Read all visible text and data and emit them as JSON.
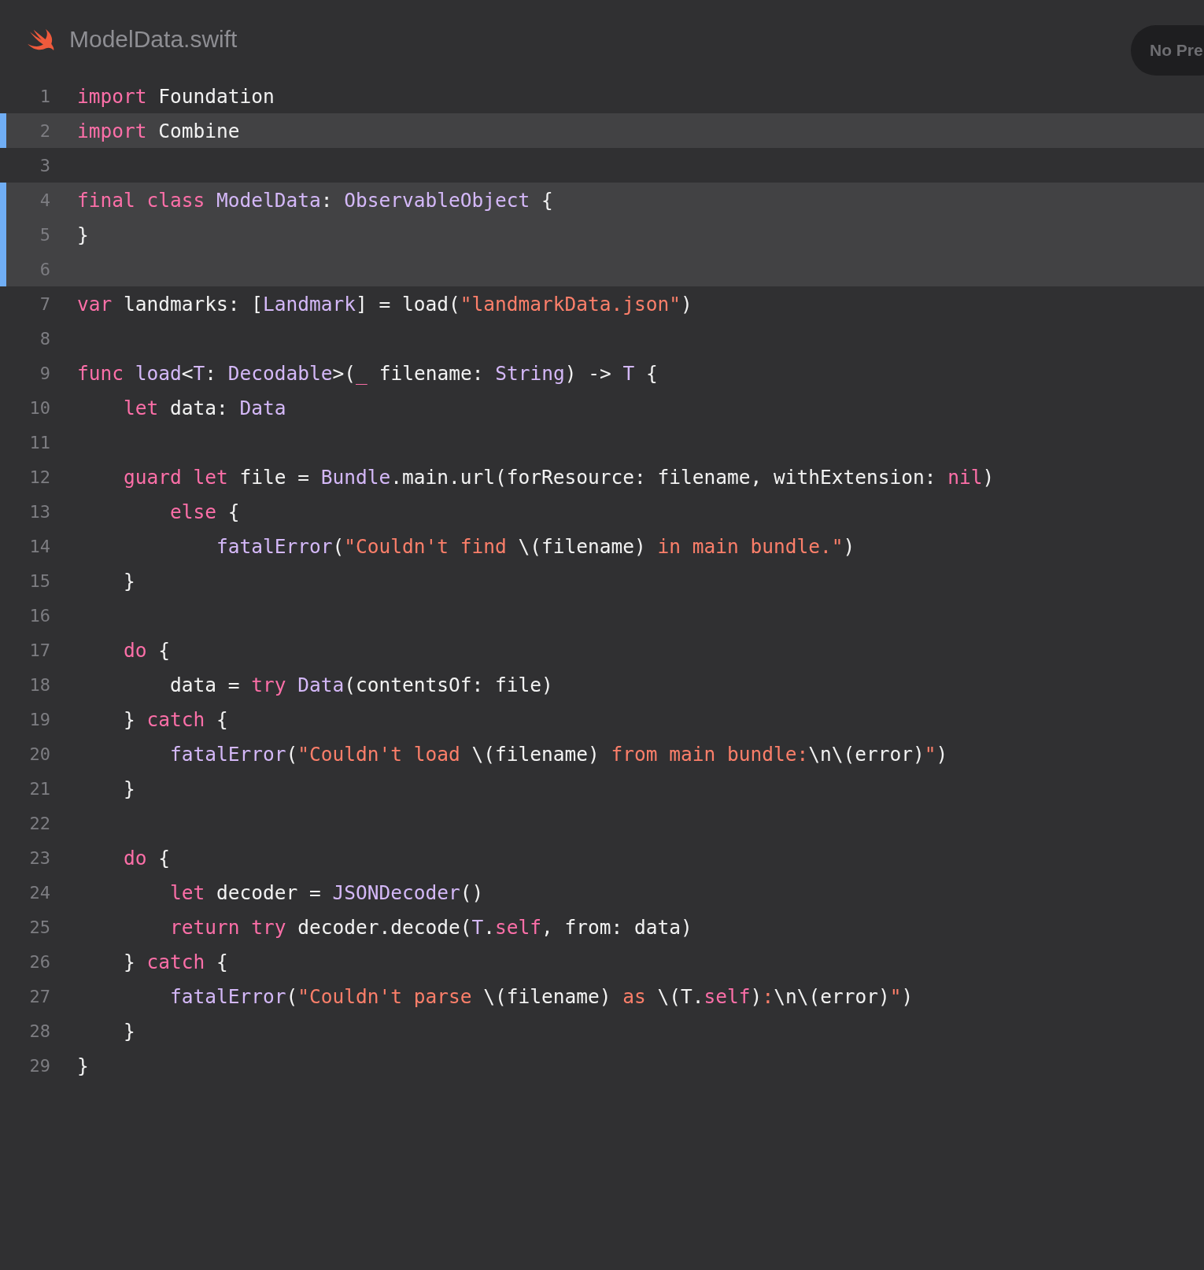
{
  "file": {
    "title": "ModelData.swift"
  },
  "preview_button": {
    "label": "No Pre"
  },
  "lines": [
    {
      "number": "1",
      "highlighted": false,
      "tokens": [
        {
          "kind": "keyword",
          "text": "import"
        },
        {
          "kind": "plain",
          "text": " Foundation"
        }
      ]
    },
    {
      "number": "2",
      "highlighted": true,
      "tokens": [
        {
          "kind": "keyword",
          "text": "import"
        },
        {
          "kind": "plain",
          "text": " Combine"
        }
      ]
    },
    {
      "number": "3",
      "highlighted": false
    },
    {
      "number": "4",
      "highlighted": true,
      "tokens": [
        {
          "kind": "keyword",
          "text": "final class"
        },
        {
          "kind": "type",
          "text": " ModelData"
        },
        {
          "kind": "plain",
          "text": ": "
        },
        {
          "kind": "type",
          "text": "ObservableObject"
        },
        {
          "kind": "plain",
          "text": " {"
        }
      ]
    },
    {
      "number": "5",
      "highlighted": true,
      "tokens": [
        {
          "kind": "plain",
          "text": "}"
        }
      ]
    },
    {
      "number": "6",
      "highlighted": true
    },
    {
      "number": "7",
      "highlighted": false,
      "tokens": [
        {
          "kind": "keyword",
          "text": "var"
        },
        {
          "kind": "plain",
          "text": " landmarks: ["
        },
        {
          "kind": "type",
          "text": "Landmark"
        },
        {
          "kind": "plain",
          "text": "] = load("
        },
        {
          "kind": "string",
          "text": "\"landmarkData.json\""
        },
        {
          "kind": "plain",
          "text": ")"
        }
      ]
    },
    {
      "number": "8",
      "highlighted": false
    },
    {
      "number": "9",
      "highlighted": false,
      "tokens": [
        {
          "kind": "keyword",
          "text": "func"
        },
        {
          "kind": "type",
          "text": " load"
        },
        {
          "kind": "plain",
          "text": "<"
        },
        {
          "kind": "type",
          "text": "T"
        },
        {
          "kind": "plain",
          "text": ": "
        },
        {
          "kind": "type",
          "text": "Decodable"
        },
        {
          "kind": "plain",
          "text": ">("
        },
        {
          "kind": "keyword",
          "text": "_"
        },
        {
          "kind": "plain",
          "text": " filename: "
        },
        {
          "kind": "type",
          "text": "String"
        },
        {
          "kind": "plain",
          "text": ") -> "
        },
        {
          "kind": "type",
          "text": "T"
        },
        {
          "kind": "plain",
          "text": " {"
        }
      ]
    },
    {
      "number": "10",
      "highlighted": false,
      "tokens": [
        {
          "kind": "keyword",
          "text": "    let"
        },
        {
          "kind": "plain",
          "text": " data: "
        },
        {
          "kind": "type",
          "text": "Data"
        }
      ]
    },
    {
      "number": "11",
      "highlighted": false
    },
    {
      "number": "12",
      "highlighted": false,
      "tokens": [
        {
          "kind": "keyword",
          "text": "    guard let"
        },
        {
          "kind": "plain",
          "text": " file = "
        },
        {
          "kind": "type",
          "text": "Bundle"
        },
        {
          "kind": "plain",
          "text": ".main.url(forResource: filename, withExtension: "
        },
        {
          "kind": "keyword",
          "text": "nil"
        },
        {
          "kind": "plain",
          "text": ")"
        }
      ]
    },
    {
      "number": "13",
      "highlighted": false,
      "tokens": [
        {
          "kind": "keyword",
          "text": "        else"
        },
        {
          "kind": "plain",
          "text": " {"
        }
      ]
    },
    {
      "number": "14",
      "highlighted": false,
      "tokens": [
        {
          "kind": "type",
          "text": "            fatalError"
        },
        {
          "kind": "plain",
          "text": "("
        },
        {
          "kind": "string",
          "text": "\"Couldn't find "
        },
        {
          "kind": "plain",
          "text": "\\(filename)"
        },
        {
          "kind": "string",
          "text": " in main bundle.\""
        },
        {
          "kind": "plain",
          "text": ")"
        }
      ]
    },
    {
      "number": "15",
      "highlighted": false,
      "tokens": [
        {
          "kind": "plain",
          "text": "    }"
        }
      ]
    },
    {
      "number": "16",
      "highlighted": false
    },
    {
      "number": "17",
      "highlighted": false,
      "tokens": [
        {
          "kind": "keyword",
          "text": "    do"
        },
        {
          "kind": "plain",
          "text": " {"
        }
      ]
    },
    {
      "number": "18",
      "highlighted": false,
      "tokens": [
        {
          "kind": "plain",
          "text": "        data = "
        },
        {
          "kind": "keyword",
          "text": "try"
        },
        {
          "kind": "type",
          "text": " Data"
        },
        {
          "kind": "plain",
          "text": "(contentsOf: file)"
        }
      ]
    },
    {
      "number": "19",
      "highlighted": false,
      "tokens": [
        {
          "kind": "plain",
          "text": "    } "
        },
        {
          "kind": "keyword",
          "text": "catch"
        },
        {
          "kind": "plain",
          "text": " {"
        }
      ]
    },
    {
      "number": "20",
      "highlighted": false,
      "tokens": [
        {
          "kind": "type",
          "text": "        fatalError"
        },
        {
          "kind": "plain",
          "text": "("
        },
        {
          "kind": "string",
          "text": "\"Couldn't load "
        },
        {
          "kind": "plain",
          "text": "\\(filename)"
        },
        {
          "kind": "string",
          "text": " from main bundle:"
        },
        {
          "kind": "plain",
          "text": "\\n\\(error)"
        },
        {
          "kind": "string",
          "text": "\""
        },
        {
          "kind": "plain",
          "text": ")"
        }
      ]
    },
    {
      "number": "21",
      "highlighted": false,
      "tokens": [
        {
          "kind": "plain",
          "text": "    }"
        }
      ]
    },
    {
      "number": "22",
      "highlighted": false
    },
    {
      "number": "23",
      "highlighted": false,
      "tokens": [
        {
          "kind": "keyword",
          "text": "    do"
        },
        {
          "kind": "plain",
          "text": " {"
        }
      ]
    },
    {
      "number": "24",
      "highlighted": false,
      "tokens": [
        {
          "kind": "keyword",
          "text": "        let"
        },
        {
          "kind": "plain",
          "text": " decoder = "
        },
        {
          "kind": "type",
          "text": "JSONDecoder"
        },
        {
          "kind": "plain",
          "text": "()"
        }
      ]
    },
    {
      "number": "25",
      "highlighted": false,
      "tokens": [
        {
          "kind": "keyword",
          "text": "        return try"
        },
        {
          "kind": "plain",
          "text": " decoder.decode("
        },
        {
          "kind": "type",
          "text": "T"
        },
        {
          "kind": "plain",
          "text": "."
        },
        {
          "kind": "keyword",
          "text": "self"
        },
        {
          "kind": "plain",
          "text": ", from: data)"
        }
      ]
    },
    {
      "number": "26",
      "highlighted": false,
      "tokens": [
        {
          "kind": "plain",
          "text": "    } "
        },
        {
          "kind": "keyword",
          "text": "catch"
        },
        {
          "kind": "plain",
          "text": " {"
        }
      ]
    },
    {
      "number": "27",
      "highlighted": false,
      "tokens": [
        {
          "kind": "type",
          "text": "        fatalError"
        },
        {
          "kind": "plain",
          "text": "("
        },
        {
          "kind": "string",
          "text": "\"Couldn't parse "
        },
        {
          "kind": "plain",
          "text": "\\(filename)"
        },
        {
          "kind": "string",
          "text": " as "
        },
        {
          "kind": "plain",
          "text": "\\(T."
        },
        {
          "kind": "keyword",
          "text": "self"
        },
        {
          "kind": "plain",
          "text": ")"
        },
        {
          "kind": "string",
          "text": ":"
        },
        {
          "kind": "plain",
          "text": "\\n\\(error)"
        },
        {
          "kind": "string",
          "text": "\""
        },
        {
          "kind": "plain",
          "text": ")"
        }
      ]
    },
    {
      "number": "28",
      "highlighted": false,
      "tokens": [
        {
          "kind": "plain",
          "text": "    }"
        }
      ]
    },
    {
      "number": "29",
      "highlighted": false,
      "tokens": [
        {
          "kind": "plain",
          "text": "}"
        }
      ]
    }
  ]
}
